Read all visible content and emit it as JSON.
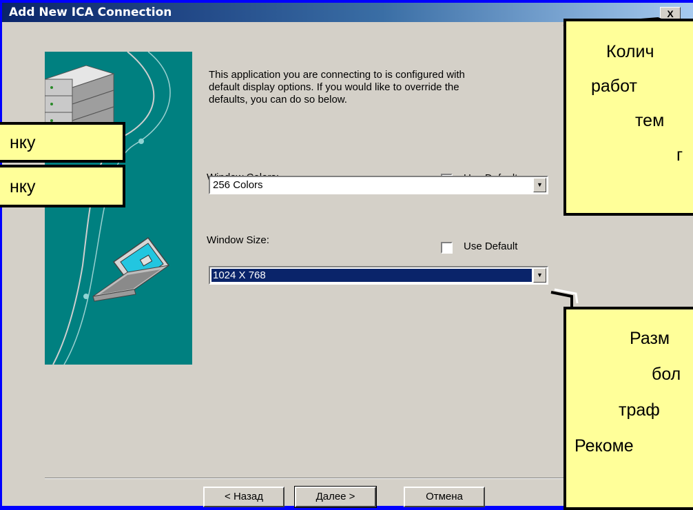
{
  "window": {
    "title": "Add New ICA Connection",
    "close_glyph": "X"
  },
  "intro_text": "This application you are connecting to is configured with\ndefault display options.  If you would like to override the\ndefaults, you can do so below.",
  "colors": {
    "label": "Window Colors:",
    "use_default_label": "Use Default",
    "use_default_checked": false,
    "value": "256 Colors"
  },
  "size": {
    "label": "Window Size:",
    "use_default_label": "Use Default",
    "use_default_checked": false,
    "value": "1024 X 768"
  },
  "buttons": {
    "back": "< Назад",
    "next": "Далее >",
    "cancel": "Отмена"
  },
  "callouts": {
    "left_1": "нку",
    "left_2": "нку",
    "top_right": [
      "Колич",
      "работ",
      "тем",
      "г"
    ],
    "bottom_right": [
      "Разм",
      "бол",
      "траф",
      "Рекоме"
    ]
  },
  "colors_theme": {
    "desktop": "#0000ff",
    "dialog": "#d4d0c8",
    "title_bar": "#0a246a",
    "sidebar": "#008080",
    "callout": "#ffff99",
    "selection": "#0a246a"
  }
}
